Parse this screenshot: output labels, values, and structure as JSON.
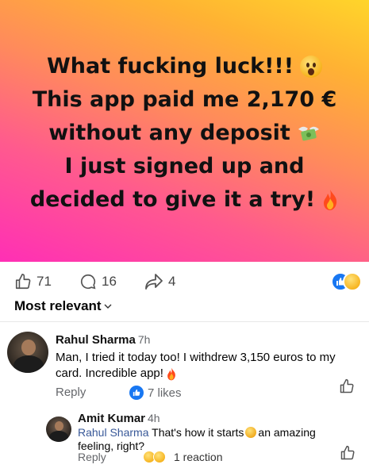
{
  "post": {
    "headline_lines": [
      "What fucking luck!!!",
      "This app paid me 2,170 €",
      "without any deposit",
      "I just signed up and",
      "decided to give it a try!"
    ],
    "colors": {
      "gradient_top": "#ffd52a",
      "gradient_bottom": "#ff2fb5"
    }
  },
  "actions": {
    "like_count": "71",
    "comment_count": "16",
    "share_count": "4"
  },
  "sort_label": "Most relevant",
  "comments": [
    {
      "author": "Rahul Sharma",
      "time": "7h",
      "text_line1": "Man, I tried it today too! I withdrew 3,150 euros to my",
      "text_line2": "card. Incredible app!",
      "reply_label": "Reply",
      "likes_label": "7 likes"
    },
    {
      "author": "Amit Kumar",
      "time": "4h",
      "mention": "Rahul Sharma",
      "text_part1": "That's how it starts",
      "text_part2": "an amazing",
      "text_line2": "feeling, right?",
      "reply_label": "Reply",
      "reactions_label": "1 reaction"
    }
  ],
  "icons": [
    "like-icon",
    "comment-icon",
    "share-icon",
    "chevron-down-icon",
    "thumbs-up-icon",
    "fire-icon",
    "astonished-face-icon",
    "money-wings-icon"
  ]
}
